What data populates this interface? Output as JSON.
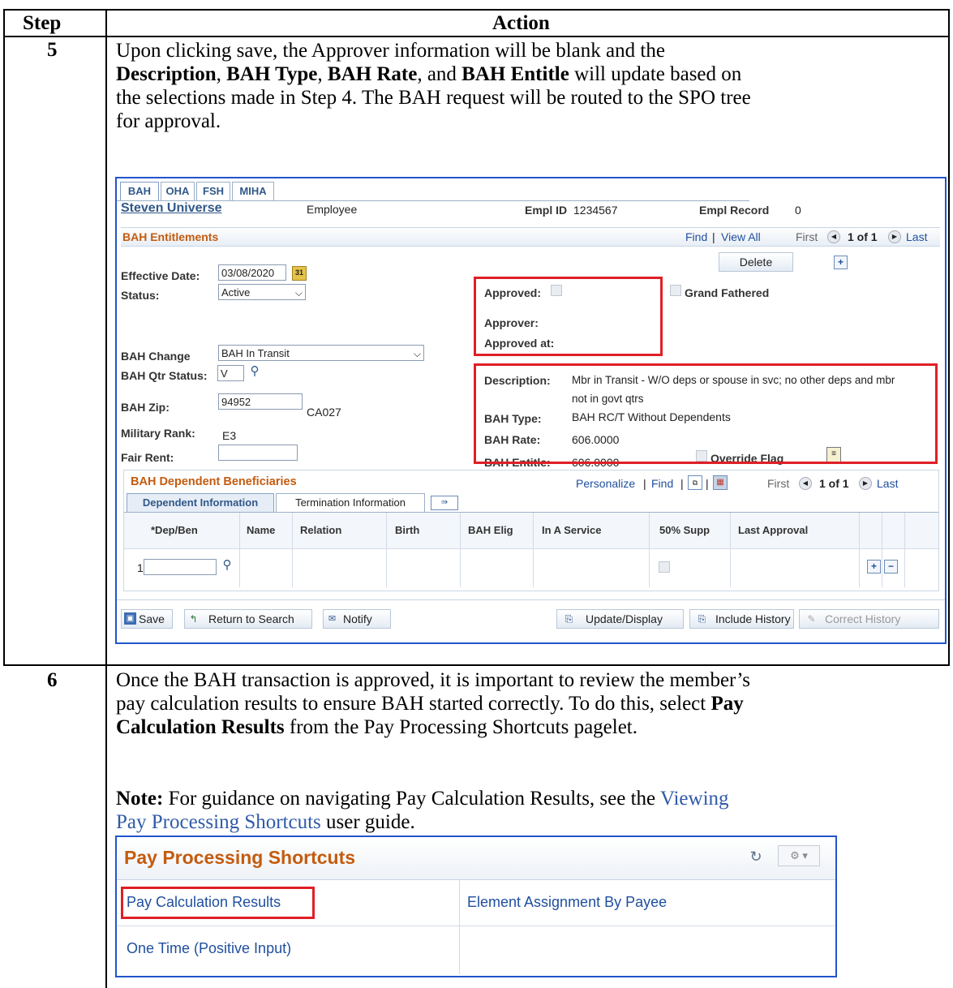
{
  "header": {
    "step": "Step",
    "action": "Action"
  },
  "step5": {
    "number": "5",
    "text_1": "Upon clicking save, the Approver information will be blank and the",
    "b_description": "Description",
    "sep_1": ", ",
    "b_bah_type": "BAH Type",
    "sep_2": ", ",
    "b_bah_rate": "BAH Rate",
    "sep_3": ", and ",
    "b_bah_entitle": "BAH Entitle",
    "text_2": " will update based on",
    "text_3": "the selections made in Step 4.  The BAH request will be routed to the SPO tree",
    "text_4": "for approval."
  },
  "bah_page": {
    "tabs": [
      "BAH",
      "OHA",
      "FSH",
      "MIHA"
    ],
    "employee_name": "Steven Universe",
    "employee_type": "Employee",
    "empl_id_label": "Empl ID",
    "empl_id": "1234567",
    "empl_record_label": "Empl Record",
    "empl_record": "0",
    "section_title": "BAH Entitlements",
    "find": "Find",
    "view_all": "View All",
    "first": "First",
    "pager": "1 of 1",
    "last": "Last",
    "delete": "Delete",
    "effective_date_label": "Effective Date:",
    "effective_date": "03/08/2020",
    "status_label": "Status:",
    "status_value": "Active",
    "approved_label": "Approved:",
    "grand_fathered_label": "Grand Fathered",
    "approver_label": "Approver:",
    "approved_at_label": "Approved at:",
    "bah_change_label": "BAH Change",
    "bah_change_value": "BAH In Transit",
    "bah_qtr_status_label": "BAH Qtr Status:",
    "bah_qtr_status_value": "V",
    "bah_zip_label": "BAH Zip:",
    "bah_zip_value": "94952",
    "bah_zip_code": "CA027",
    "military_rank_label": "Military Rank:",
    "military_rank_value": "E3",
    "fair_rent_label": "Fair Rent:",
    "fair_rent_value": "",
    "description_label": "Description:",
    "description_value_1": "Mbr in Transit - W/O deps or spouse in svc; no other deps and mbr",
    "description_value_2": "not in govt qtrs",
    "bah_type_label": "BAH Type:",
    "bah_type_value": "BAH RC/T Without Dependents",
    "bah_rate_label": "BAH Rate:",
    "bah_rate_value": "606.0000",
    "bah_entitle_label": "BAH Entitle:",
    "bah_entitle_value": "606.0000",
    "override_flag_label": "Override Flag",
    "dependents_title": "BAH Dependent Beneficiaries",
    "personalize": "Personalize",
    "dep_tabs": [
      "Dependent Information",
      "Termination Information"
    ],
    "columns": [
      "*Dep/Ben",
      "Name",
      "Relation",
      "Birth",
      "BAH Elig",
      "In A Service",
      "50% Supp",
      "Last Approval"
    ],
    "row_number": "1",
    "buttons": {
      "save": "Save",
      "return_to_search": "Return to Search",
      "notify": "Notify",
      "update_display": "Update/Display",
      "include_history": "Include History",
      "correct_history": "Correct History"
    }
  },
  "step6": {
    "number": "6",
    "line_1": "Once the BAH transaction is approved, it is important to review the member’s",
    "line_2a": "pay calculation results to ensure BAH started correctly.  To do this, select ",
    "line_2b": "Pay",
    "line_3a": "Calculation Results",
    "line_3b": " from the Pay Processing Shortcuts pagelet.",
    "note_label": "Note:",
    "note_text": "  For guidance on navigating Pay Calculation Results, see the ",
    "note_link_1": "Viewing",
    "note_link_2": "Pay Processing Shortcuts",
    "note_end": " user guide."
  },
  "pagelet": {
    "title": "Pay Processing Shortcuts",
    "links": [
      "Pay Calculation Results",
      "Element Assignment By Payee",
      "One Time (Positive Input)"
    ]
  },
  "colors": {
    "accent_border": "#2255cc",
    "highlight": "#e01f26",
    "section_title": "#c45b0f",
    "link": "#1f4f9e"
  }
}
